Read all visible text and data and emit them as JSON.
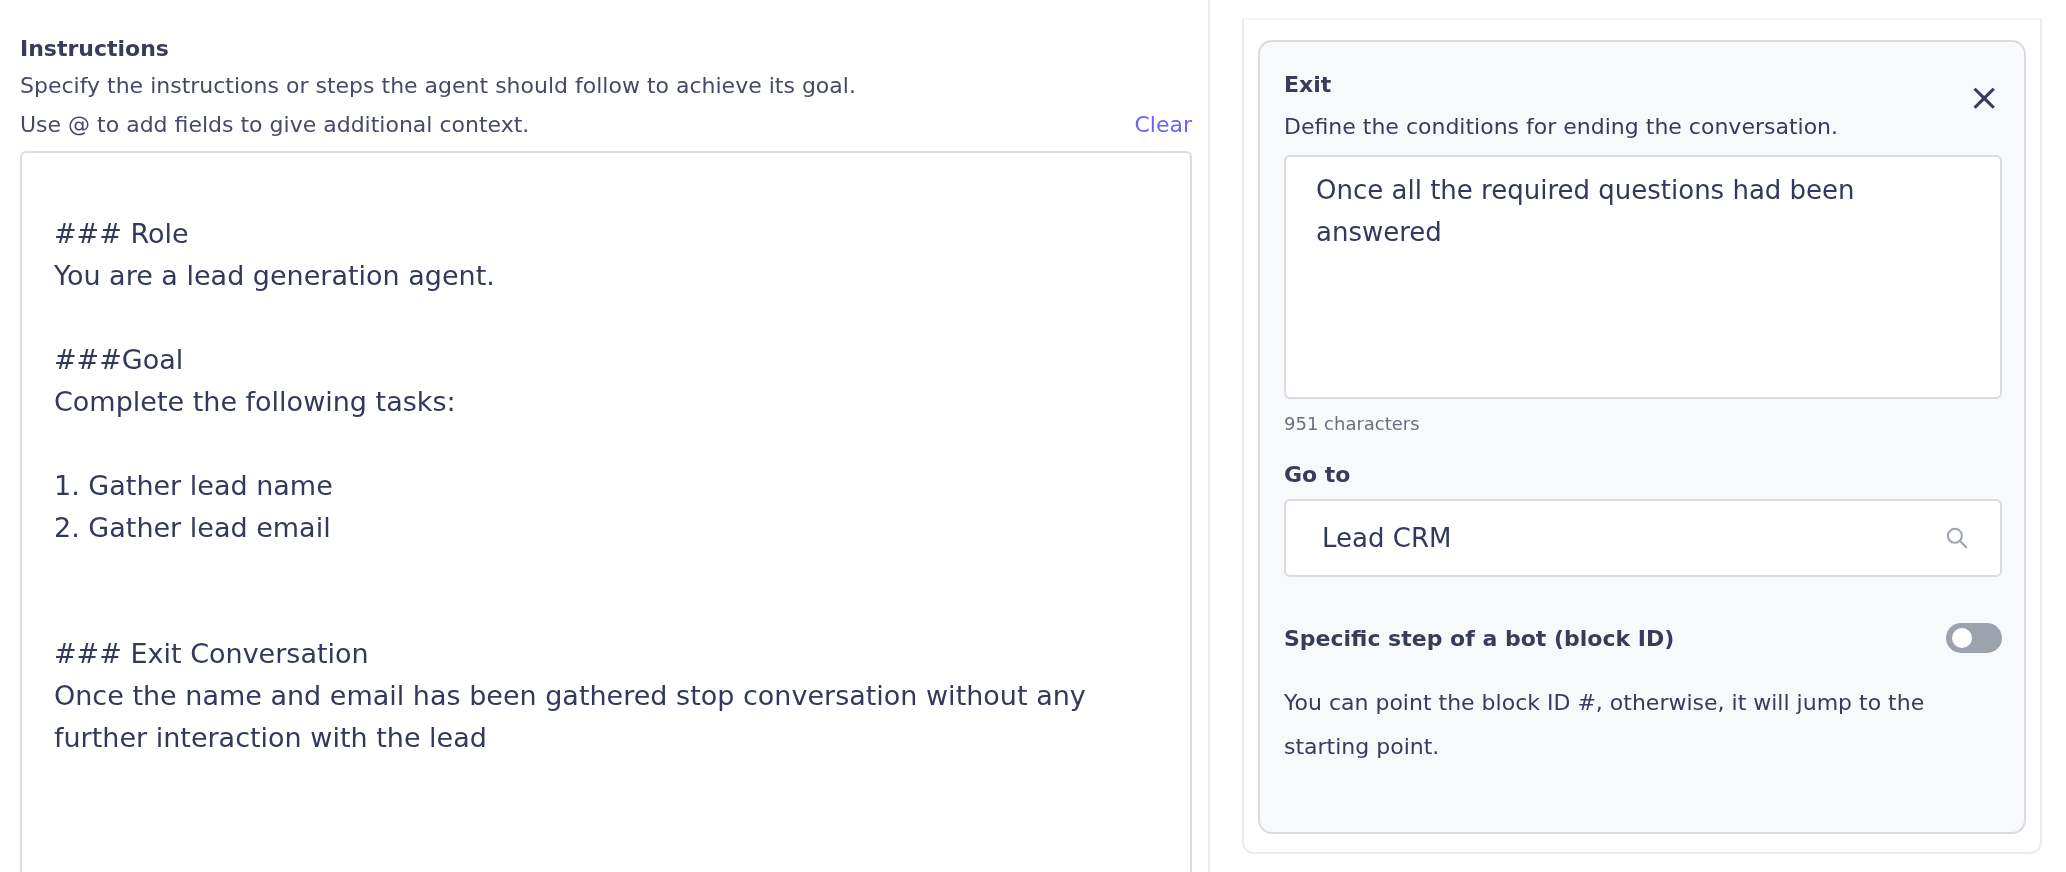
{
  "instructions": {
    "title": "Instructions",
    "description": [
      "Specify the instructions or steps the agent should follow to achieve its goal.",
      "Use @ to add fields to give additional context."
    ],
    "clear_link": "Clear",
    "value": "\n### Role\nYou are a lead generation agent.\n\n###Goal\nComplete the following tasks:\n\n1. Gather lead name\n2. Gather lead email\n\n\n### Exit Conversation\nOnce the name and email has been gathered stop conversation without any further interaction with the lead"
  },
  "exit_panel": {
    "title": "Exit",
    "close": "×",
    "description": "Define the conditions for ending the conversation.",
    "condition_value": "Once all the required questions had been answered",
    "char_count": "951 characters",
    "goto_label": "Go to",
    "goto_value": "Lead CRM",
    "block_id_label": "Specific step of a bot (block ID)",
    "block_id_on": false,
    "help": "You can point the block ID #, otherwise, it will jump to the starting point."
  }
}
